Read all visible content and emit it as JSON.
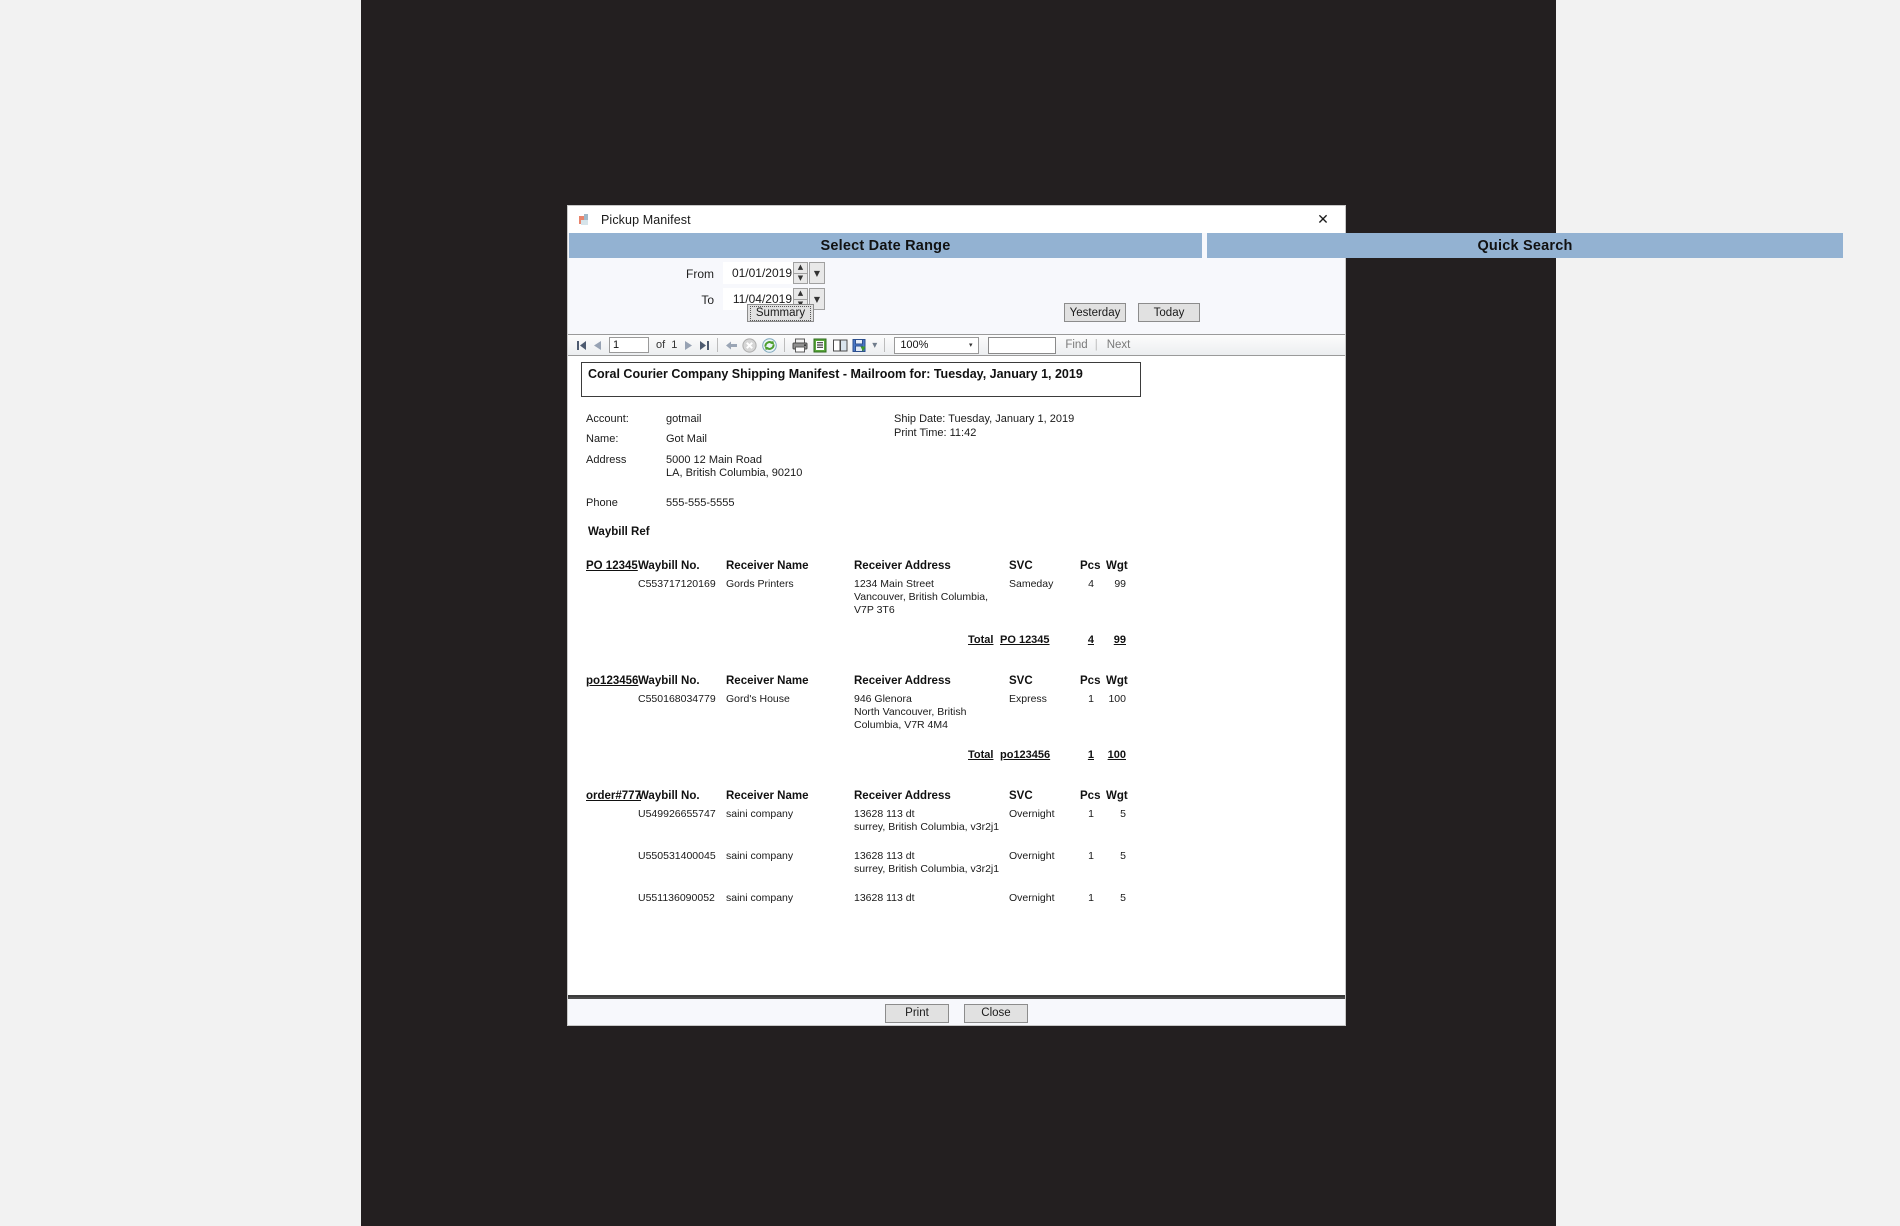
{
  "window": {
    "title": "Pickup Manifest",
    "close_label": "✕",
    "app_icon": "app-icon"
  },
  "panels": {
    "date_range_header": "Select Date Range",
    "quick_search_header": "Quick Search"
  },
  "date_range": {
    "from_label": "From",
    "from_value": "01/01/2019",
    "to_label": "To",
    "to_value": "11/04/2019",
    "summary_button": "Summary",
    "spin_up": "▲",
    "spin_down": "▼",
    "drop_arrow": "▼"
  },
  "quick_search": {
    "yesterday_button": "Yesterday",
    "today_button": "Today"
  },
  "report_toolbar": {
    "first_page": "◀◀",
    "prev_page": "◀",
    "page_value": "1",
    "of_label": "of",
    "page_count": "1",
    "next_page": "▶",
    "last_page": "▶▶",
    "back": "←",
    "stop": "stop-icon",
    "refresh": "refresh-icon",
    "print": "print-icon",
    "print_layout": "print-layout-icon",
    "page_setup": "page-setup-icon",
    "export": "export-icon",
    "export_arrow": "▾",
    "zoom_value": "100%",
    "zoom_arrow": "▾",
    "search_value": "",
    "find_label": "Find",
    "separator": "|",
    "next_label": "Next"
  },
  "report": {
    "title": "Coral Courier Company Shipping Manifest - Mailroom for: Tuesday, January 1, 2019",
    "fields": [
      {
        "label": "Account:",
        "value": "gotmail"
      },
      {
        "label": "Name:",
        "value": "Got Mail"
      }
    ],
    "address_label": "Address",
    "address_line1": "5000 12 Main Road",
    "address_line2": "LA, British Columbia, 90210",
    "phone_label": "Phone",
    "phone_value": "555-555-5555",
    "ship_date": "Ship Date: Tuesday, January 1, 2019",
    "print_time": "Print Time: 11:42",
    "waybill_ref_heading": "Waybill Ref",
    "columns": {
      "waybill_no": "Waybill No.",
      "receiver_name": "Receiver Name",
      "receiver_address": "Receiver Address",
      "svc": "SVC",
      "pcs": "Pcs",
      "wgt": "Wgt"
    },
    "total_label": "Total",
    "groups": [
      {
        "ref": "PO 12345",
        "rows": [
          {
            "waybill_no": "C553717120169",
            "receiver_name": "Gords Printers",
            "address_lines": [
              "1234 Main Street",
              "Vancouver, British Columbia,",
              "V7P 3T6"
            ],
            "svc": "Sameday",
            "pcs": "4",
            "wgt": "99"
          }
        ],
        "total_pcs": "4",
        "total_wgt": "99"
      },
      {
        "ref": "po123456",
        "rows": [
          {
            "waybill_no": "C550168034779",
            "receiver_name": "Gord's House",
            "address_lines": [
              "946 Glenora",
              "North Vancouver, British",
              "Columbia, V7R 4M4"
            ],
            "svc": "Express",
            "pcs": "1",
            "wgt": "100"
          }
        ],
        "total_pcs": "1",
        "total_wgt": "100"
      },
      {
        "ref": "order#777",
        "rows": [
          {
            "waybill_no": "U549926655747",
            "receiver_name": "saini company",
            "address_lines": [
              "13628 113 dt",
              "surrey, British Columbia, v3r2j1"
            ],
            "svc": "Overnight",
            "pcs": "1",
            "wgt": "5"
          },
          {
            "waybill_no": "U550531400045",
            "receiver_name": "saini company",
            "address_lines": [
              "13628 113 dt",
              "surrey, British Columbia, v3r2j1"
            ],
            "svc": "Overnight",
            "pcs": "1",
            "wgt": "5"
          },
          {
            "waybill_no": "U551136090052",
            "receiver_name": "saini company",
            "address_lines": [
              "13628 113 dt"
            ],
            "svc": "Overnight",
            "pcs": "1",
            "wgt": "5"
          }
        ],
        "total_pcs": "",
        "total_wgt": ""
      }
    ]
  },
  "footer": {
    "print_button": "Print",
    "close_button": "Close"
  },
  "colors": {
    "header_blue": "#93b2d2",
    "window_bg": "#f7f8fc",
    "page_bg": "#231f20",
    "outer_bg": "#f2f2f2"
  }
}
